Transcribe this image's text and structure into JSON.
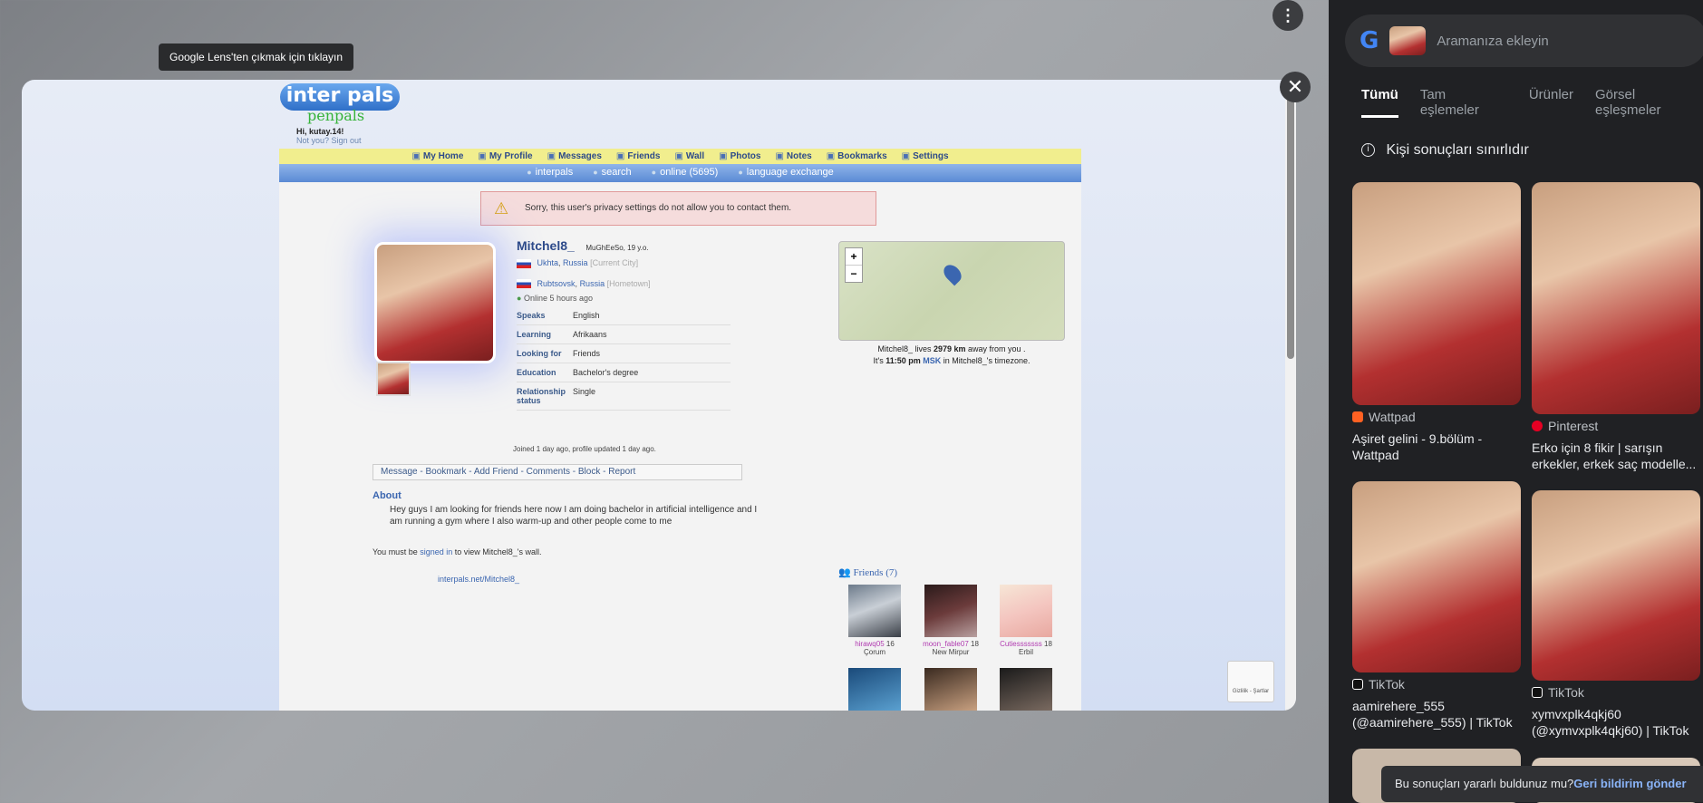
{
  "lens": {
    "exit_tooltip": "Google Lens'ten çıkmak için tıklayın"
  },
  "site": {
    "logo_main": "inter pals",
    "logo_sub": "penpals",
    "greeting": "Hi, kutay.14!",
    "not_you": "Not you? Sign out",
    "nav_primary": [
      "My Home",
      "My Profile",
      "Messages",
      "Friends",
      "Wall",
      "Photos",
      "Notes",
      "Bookmarks",
      "Settings"
    ],
    "nav_secondary": [
      "interpals",
      "search",
      "online (5695)",
      "language exchange"
    ],
    "alert": "Sorry, this user's privacy settings do not allow you to contact them."
  },
  "profile": {
    "username": "Mitchel8_",
    "meta": "MuGhEeSo, 19 y.o.",
    "current_city": "Ukhta",
    "current_country": "Russia",
    "current_label": "[Current City]",
    "home_city": "Rubtsovsk",
    "home_country": "Russia",
    "home_label": "[Hometown]",
    "online": "Online 5 hours ago",
    "fields": [
      {
        "key": "Speaks",
        "value": "English"
      },
      {
        "key": "Learning",
        "value": "Afrikaans"
      },
      {
        "key": "Looking for",
        "value": "Friends"
      },
      {
        "key": "Education",
        "value": "Bachelor's degree"
      },
      {
        "key": "Relationship status",
        "value": "Single"
      }
    ],
    "joined": "Joined 1 day ago, profile updated 1 day ago.",
    "actions": [
      "Message",
      "Bookmark",
      "Add Friend",
      "Comments",
      "Block",
      "Report"
    ],
    "about_title": "About",
    "about_text": "Hey guys I am looking for friends here now I am doing bachelor in artificial intelligence and I am running a gym where I also warm-up and other people come to me",
    "wall_pre": "You must be ",
    "wall_link": "signed in",
    "wall_post": " to view Mitchel8_'s wall.",
    "url": "interpals.net/Mitchel8_"
  },
  "map": {
    "zoom_in": "+",
    "zoom_out": "−",
    "info_pre": "Mitchel8_ lives ",
    "distance": "2979 km",
    "info_post": " away from you .",
    "time_pre": "It's ",
    "time": "11:50 pm",
    "tz": "MSK",
    "time_post": " in Mitchel8_'s timezone."
  },
  "friends": {
    "title": "Friends (7)",
    "items": [
      {
        "name": "hirawq05",
        "age": "16",
        "city": "Çorum"
      },
      {
        "name": "moon_fable07",
        "age": "18",
        "city": "New Mirpur"
      },
      {
        "name": "Cutiesssssss",
        "age": "18",
        "city": "Erbil"
      }
    ]
  },
  "recaptcha": "Gizlilik - Şartlar",
  "lens_panel": {
    "search_placeholder": "Aramanıza ekleyin",
    "tabs": [
      "Tümü",
      "Tam eşlemeler",
      "Ürünler",
      "Görsel eşleşmeler"
    ],
    "notice": "Kişi sonuçları sınırlıdır",
    "results": [
      {
        "source": "Wattpad",
        "title": "Aşiret gelini - 9.bölüm - Wattpad",
        "color": "#ff6122"
      },
      {
        "source": "Pinterest",
        "title": "Erko için 8 fikir | sarışın erkekler, erkek saç modelle...",
        "color": "#e60023"
      },
      {
        "source": "TikTok",
        "title": "aamirehere_555 (@aamirehere_555) | TikTok",
        "color": "#ffffff"
      },
      {
        "source": "TikTok",
        "title": "xymvxplk4qkj60 (@xymvxplk4qkj60) | TikTok",
        "color": "#ffffff"
      }
    ],
    "feedback_q": "Bu sonuçları yararlı buldunuz mu?",
    "feedback_link": "Geri bildirim gönder"
  }
}
